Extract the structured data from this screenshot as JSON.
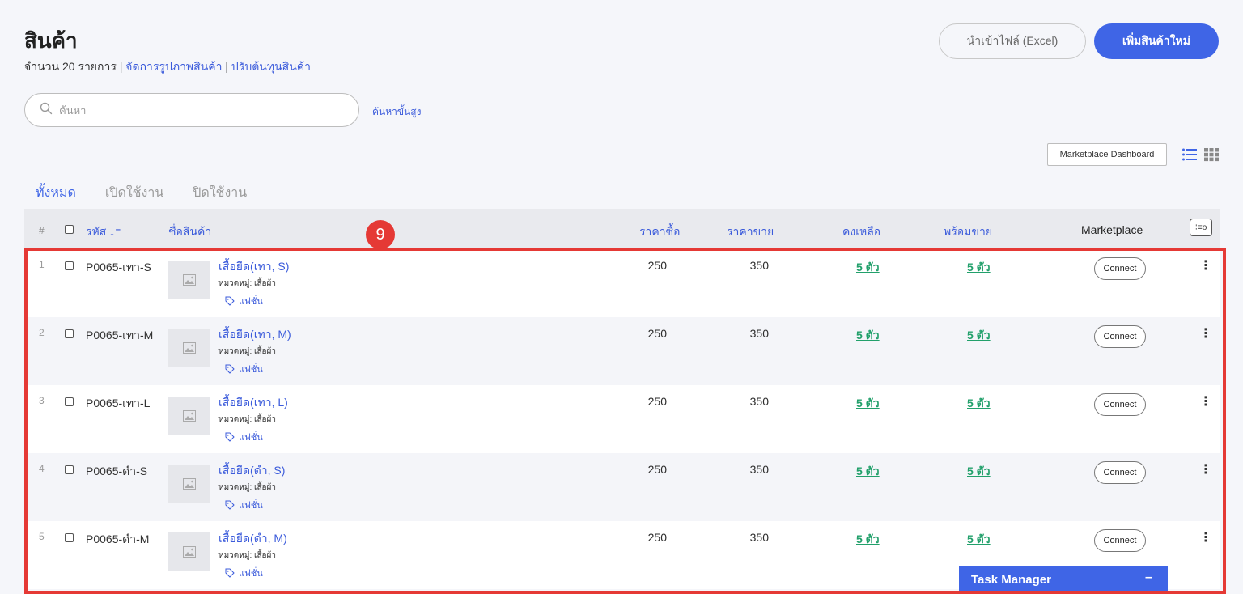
{
  "header": {
    "title": "สินค้า",
    "count_text": "จำนวน 20 รายการ",
    "sep1": " | ",
    "manage_images": "จัดการรูปภาพสินค้า",
    "sep2": " | ",
    "adjust_cost": "ปรับต้นทุนสินค้า",
    "import_button": "นำเข้าไฟล์ (Excel)",
    "add_button": "เพิ่มสินค้าใหม่"
  },
  "search": {
    "placeholder": "ค้นหา",
    "advanced": "ค้นหาขั้นสูง"
  },
  "toolbar": {
    "marketplace_dashboard": "Marketplace Dashboard"
  },
  "tabs": [
    {
      "label": "ทั้งหมด",
      "active": true
    },
    {
      "label": "เปิดใช้งาน",
      "active": false
    },
    {
      "label": "ปิดใช้งาน",
      "active": false
    }
  ],
  "table": {
    "headers": {
      "hash": "#",
      "code": "รหัส ↓⁼",
      "name": "ชื่อสินค้า",
      "buy": "ราคาซื้อ",
      "sell": "ราคาขาย",
      "remain": "คงเหลือ",
      "ready": "พร้อมขาย",
      "marketplace": "Marketplace",
      "settings": "⁝≡o"
    },
    "rows": [
      {
        "num": "1",
        "code": "P0065-เทา-S",
        "name": "เสื้อยืด(เทา, S)",
        "category": "หมวดหมู่: เสื้อผ้า",
        "tag": "แฟชั่น",
        "buy": "250",
        "sell": "350",
        "remain": "5 ตัว",
        "ready": "5 ตัว",
        "connect": "Connect"
      },
      {
        "num": "2",
        "code": "P0065-เทา-M",
        "name": "เสื้อยืด(เทา, M)",
        "category": "หมวดหมู่: เสื้อผ้า",
        "tag": "แฟชั่น",
        "buy": "250",
        "sell": "350",
        "remain": "5 ตัว",
        "ready": "5 ตัว",
        "connect": "Connect"
      },
      {
        "num": "3",
        "code": "P0065-เทา-L",
        "name": "เสื้อยืด(เทา, L)",
        "category": "หมวดหมู่: เสื้อผ้า",
        "tag": "แฟชั่น",
        "buy": "250",
        "sell": "350",
        "remain": "5 ตัว",
        "ready": "5 ตัว",
        "connect": "Connect"
      },
      {
        "num": "4",
        "code": "P0065-ดำ-S",
        "name": "เสื้อยืด(ดำ, S)",
        "category": "หมวดหมู่: เสื้อผ้า",
        "tag": "แฟชั่น",
        "buy": "250",
        "sell": "350",
        "remain": "5 ตัว",
        "ready": "5 ตัว",
        "connect": "Connect"
      },
      {
        "num": "5",
        "code": "P0065-ดำ-M",
        "name": "เสื้อยืด(ดำ, M)",
        "category": "หมวดหมู่: เสื้อผ้า",
        "tag": "แฟชั่น",
        "buy": "250",
        "sell": "350",
        "remain": "5 ตัว",
        "ready": "5 ตัว",
        "connect": "Connect"
      }
    ]
  },
  "annotation": {
    "badge": "9"
  },
  "task_manager": {
    "label": "Task Manager",
    "minimize": "–"
  },
  "colors": {
    "accent": "#3f65e6",
    "link": "#3b5bdb",
    "stock_green": "#22a06b",
    "highlight_red": "#e53935"
  }
}
